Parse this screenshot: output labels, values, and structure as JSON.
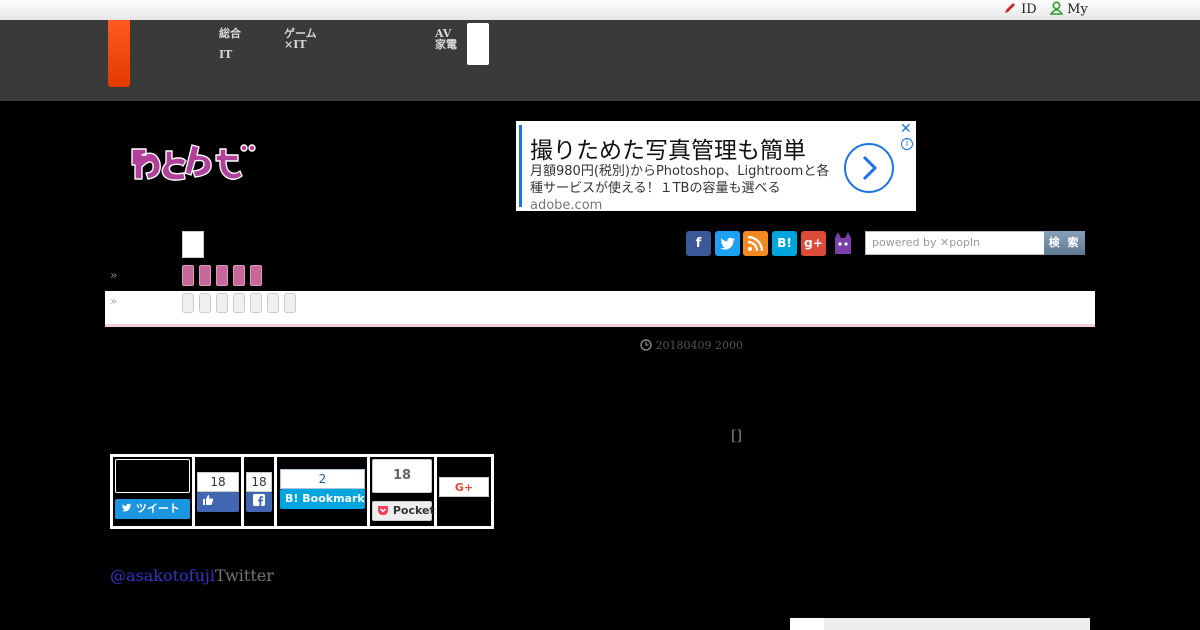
{
  "topbar": {
    "id_label": "ID",
    "my_label": "My"
  },
  "nav": {
    "item1_line1": "総合",
    "item1_line2": "IT",
    "item2_line1": "ゲーム",
    "item2_line2": "×IT",
    "item3_line1": "AV",
    "item3_line2": "家電"
  },
  "ad": {
    "headline": "撮りためた写真管理も簡単",
    "body": "月額980円(税別)からPhotoshop、Lightroomと各種サービスが使える！１TBの容量も選べる",
    "domain": "adobe.com",
    "close_glyph": "✕",
    "info_glyph": "i",
    "arrow_glyph": "›"
  },
  "search": {
    "placeholder": "powered by ✕popIn",
    "button_label": "検 索"
  },
  "social_icons": [
    "facebook-icon",
    "twitter-icon",
    "rss-icon",
    "hatena-icon",
    "googleplus-icon",
    "nekomimi-icon"
  ],
  "breadcrumb": {
    "separator": "»"
  },
  "article": {
    "date": "20180409 2000",
    "bracket_text": "[]",
    "twitter_handle": "@asakotofuji",
    "twitter_suffix": "Twitter"
  },
  "share": {
    "tweet_label": "ツイート",
    "like_count": "18",
    "fb_share_count": "18",
    "bookmark_count": "2",
    "bookmark_label": "Bookmark",
    "pocket_count": "18",
    "pocket_label": "Pocket",
    "gplus_label": "G+"
  },
  "colors": {
    "accent_orange": "#ff5a1f",
    "pink": "#c8679a",
    "link": "#3333cc",
    "facebook": "#3b5998",
    "twitter": "#1da1f2",
    "hatena": "#00a4de"
  }
}
